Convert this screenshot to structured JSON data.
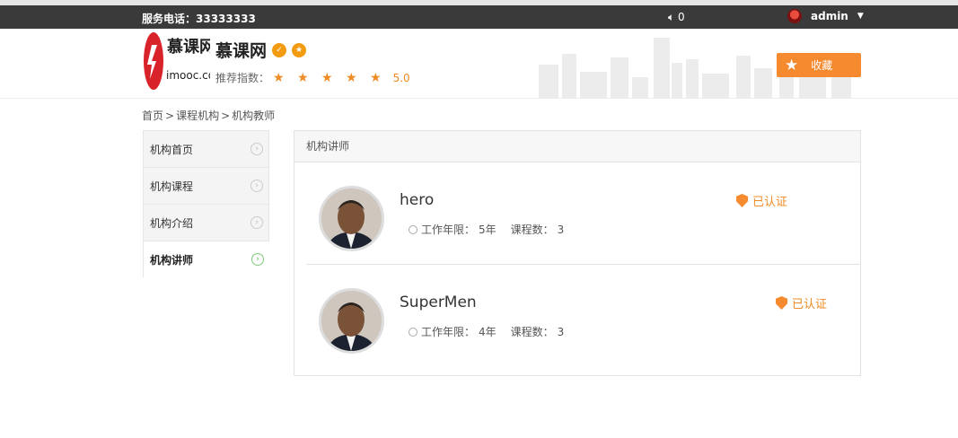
{
  "topbar": {
    "hotline": "服务电话：33333333",
    "messages_count": "0",
    "username": "admin"
  },
  "header": {
    "logo_text_top": "慕课网",
    "logo_text_bottom": "imooc.com",
    "org_name": "慕课网",
    "rating_label": "推荐指数：",
    "rating_stars": "★ ★ ★ ★ ★",
    "rating_score": "5.0",
    "favorite_label": "收藏"
  },
  "breadcrumb": {
    "home": "首页",
    "sep": ">",
    "orgs": "课程机构",
    "current": "机构教师"
  },
  "sidebar": {
    "items": [
      {
        "label": "机构首页"
      },
      {
        "label": "机构课程"
      },
      {
        "label": "机构介绍"
      },
      {
        "label": "机构讲师"
      }
    ]
  },
  "panel": {
    "title": "机构讲师",
    "teachers": [
      {
        "name": "hero",
        "cert": "已认证",
        "years_label": "工作年限：",
        "years": "5年",
        "courses_label": "课程数：",
        "courses": "3"
      },
      {
        "name": "SuperMen",
        "cert": "已认证",
        "years_label": "工作年限：",
        "years": "4年",
        "courses_label": "课程数：",
        "courses": "3"
      }
    ]
  },
  "colors": {
    "accent": "#f58a2f",
    "topbar": "#3a3a3a",
    "active_arrow": "#7dc97d"
  }
}
